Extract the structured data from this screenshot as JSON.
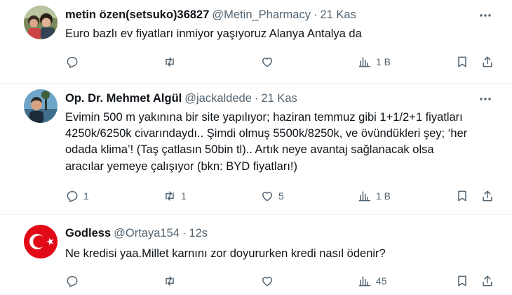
{
  "tweets": [
    {
      "name": "metin özen(setsuko)36827",
      "handle": "@Metin_Pharmacy",
      "separator": "·",
      "time": "21 Kas",
      "text": "Euro bazlı ev fiyatları inmiyor yaşıyoruz Alanya Antalya da",
      "replies": "",
      "reposts": "",
      "likes": "",
      "views": "1 B",
      "avatar_icon": "group-photo-avatar"
    },
    {
      "name": "Op. Dr. Mehmet Algül",
      "handle": "@jackaldede",
      "separator": "·",
      "time": "21 Kas",
      "text": "Evimin 500 m yakınına bir site yapılıyor; haziran temmuz gibi 1+1/2+1 fiyatları 4250k/6250k civarındaydı.. Şimdi olmuş 5500k/8250k, ve övündükleri şey; ‘her odada klima’! (Taş çatlasın 50bin tl).. Artık neye avantaj sağlanacak olsa aracılar yemeye çalışıyor (bkn: BYD fiyatları!)",
      "replies": "1",
      "reposts": "1",
      "likes": "5",
      "views": "1 B",
      "avatar_icon": "portrait-avatar"
    },
    {
      "name": "Godless",
      "handle": "@Ortaya154",
      "separator": "·",
      "time": "12s",
      "text": "Ne kredisi yaa.Millet karnını zor doyururken kredi nasıl ödenir?",
      "replies": "",
      "reposts": "",
      "likes": "",
      "views": "45",
      "avatar_icon": "turkish-flag-avatar"
    }
  ],
  "colors": {
    "text": "#0f1419",
    "muted": "#536471",
    "divider": "#eff3f4",
    "flag_red": "#e30a17"
  },
  "icons": [
    "reply-icon",
    "repost-icon",
    "like-icon",
    "views-icon",
    "bookmark-icon",
    "share-icon",
    "more-icon"
  ]
}
